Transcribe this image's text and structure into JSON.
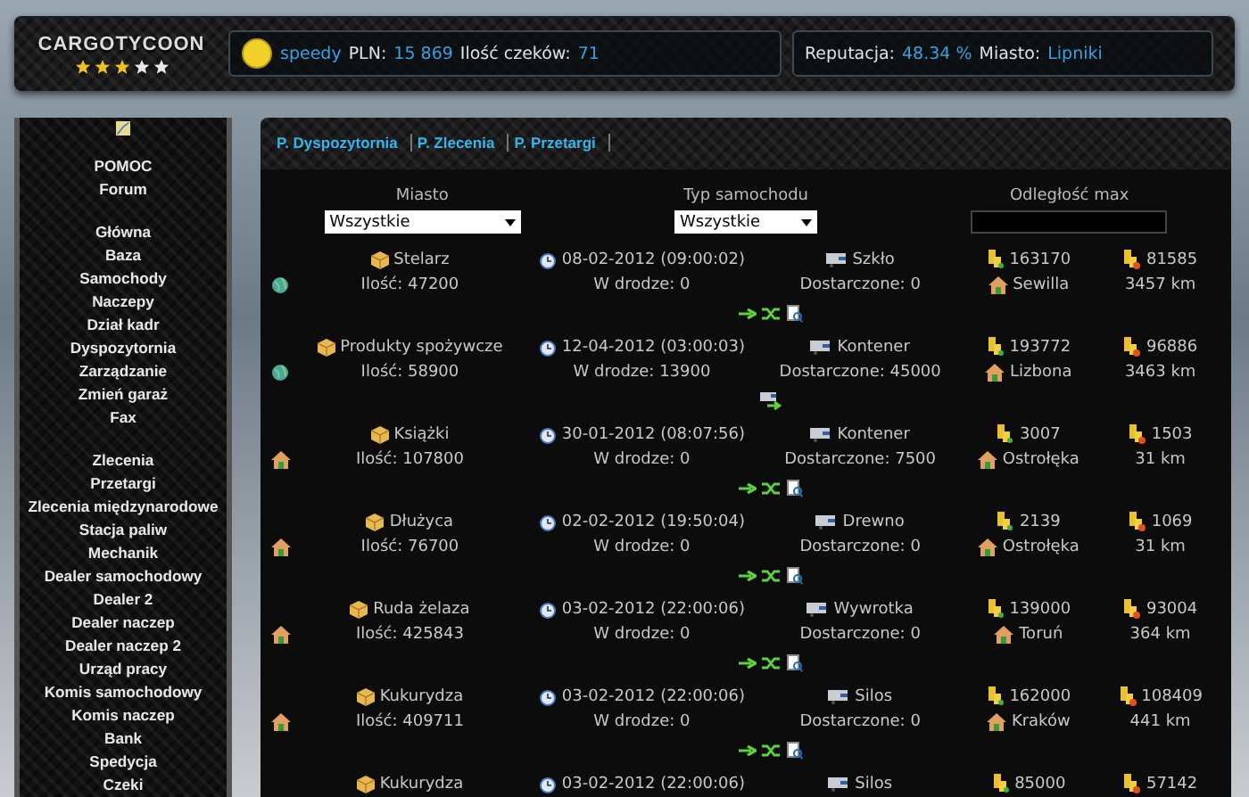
{
  "header": {
    "logo": "CARGOTYCOON",
    "stars": 3,
    "player": {
      "name": "speedy",
      "money_label": "PLN:",
      "money": "15 869",
      "checks_label": "Ilość czeków:",
      "checks": "71"
    },
    "status": {
      "reputation_label": "Reputacja:",
      "reputation": "48.34 %",
      "city_label": "Miasto:",
      "city": "Lipniki"
    }
  },
  "sidebar": {
    "groups": [
      [
        "POMOC",
        "Forum"
      ],
      [
        "Główna",
        "Baza",
        "Samochody",
        "Naczepy",
        "Dział kadr",
        "Dyspozytornia",
        "Zarządzanie",
        "Zmień garaż",
        "Fax"
      ],
      [
        "Zlecenia",
        "Przetargi",
        "Zlecenia międzynarodowe",
        "Stacja paliw",
        "Mechanik",
        "Dealer samochodowy",
        "Dealer 2",
        "Dealer naczep",
        "Dealer naczep 2",
        "Urząd pracy",
        "Komis samochodowy",
        "Komis naczep",
        "Bank",
        "Spedycja",
        "Czeki"
      ]
    ]
  },
  "tabs": [
    {
      "label": "P. Dyspozytornia"
    },
    {
      "label": "P. Zlecenia"
    },
    {
      "label": "P. Przetargi"
    }
  ],
  "filters": [
    {
      "kind": "select",
      "label": "Miasto",
      "value": "Wszystkie"
    },
    {
      "kind": "select",
      "label": "Typ samochodu",
      "value": "Wszystkie"
    },
    {
      "kind": "input",
      "label": "Odległość max"
    }
  ],
  "orders": [
    {
      "abroad": true,
      "cargo": "Stelarz",
      "date": "08-02-2012 (09:00:02)",
      "trailer": "Szkło",
      "pay": "163170",
      "bonus": "81585",
      "quantity": "Ilość: 47200",
      "in_transit": "W drodze: 0",
      "delivered": "Dostarczone: 0",
      "city": "Sewilla",
      "distance": "3457 km",
      "in_progress": false
    },
    {
      "abroad": true,
      "cargo": "Produkty spożywcze",
      "date": "12-04-2012 (03:00:03)",
      "trailer": "Kontener",
      "pay": "193772",
      "bonus": "96886",
      "quantity": "Ilość: 58900",
      "in_transit": "W drodze: 13900",
      "delivered": "Dostarczone: 45000",
      "city": "Lizbona",
      "distance": "3463 km",
      "in_progress": true
    },
    {
      "abroad": false,
      "cargo": "Książki",
      "date": "30-01-2012 (08:07:56)",
      "trailer": "Kontener",
      "pay": "3007",
      "bonus": "1503",
      "quantity": "Ilość: 107800",
      "in_transit": "W drodze: 0",
      "delivered": "Dostarczone: 7500",
      "city": "Ostrołęka",
      "distance": "31 km",
      "in_progress": false
    },
    {
      "abroad": false,
      "cargo": "Dłużyca",
      "date": "02-02-2012 (19:50:04)",
      "trailer": "Drewno",
      "pay": "2139",
      "bonus": "1069",
      "quantity": "Ilość: 76700",
      "in_transit": "W drodze: 0",
      "delivered": "Dostarczone: 0",
      "city": "Ostrołęka",
      "distance": "31 km",
      "in_progress": false
    },
    {
      "abroad": false,
      "cargo": "Ruda żelaza",
      "date": "03-02-2012 (22:00:06)",
      "trailer": "Wywrotka",
      "pay": "139000",
      "bonus": "93004",
      "quantity": "Ilość: 425843",
      "in_transit": "W drodze: 0",
      "delivered": "Dostarczone: 0",
      "city": "Toruń",
      "distance": "364 km",
      "in_progress": false
    },
    {
      "abroad": false,
      "cargo": "Kukurydza",
      "date": "03-02-2012 (22:00:06)",
      "trailer": "Silos",
      "pay": "162000",
      "bonus": "108409",
      "quantity": "Ilość: 409711",
      "in_transit": "W drodze: 0",
      "delivered": "Dostarczone: 0",
      "city": "Kraków",
      "distance": "441 km",
      "in_progress": false
    },
    {
      "cargo": "Kukurydza",
      "date": "03-02-2012 (22:00:06)",
      "trailer": "Silos",
      "pay": "85000",
      "bonus": "57142"
    }
  ]
}
